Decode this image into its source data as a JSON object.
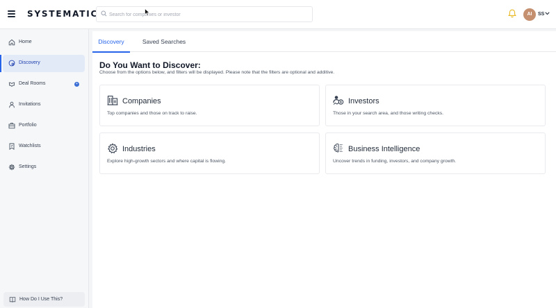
{
  "app": {
    "logo": "SYSTEMATIC",
    "search_placeholder": "Search for companies or investor"
  },
  "user": {
    "avatar_initials": "AI",
    "initials": "SS"
  },
  "colors": {
    "accent": "#2563eb",
    "bell": "#e8b923",
    "avatar": "#c4906f"
  },
  "sidebar": {
    "items": [
      {
        "label": "Home",
        "icon": "home-icon"
      },
      {
        "label": "Discovery",
        "icon": "compass-icon",
        "active": true
      },
      {
        "label": "Deal Rooms",
        "icon": "handshake-icon",
        "badge": "+"
      },
      {
        "label": "Invitations",
        "icon": "user-icon"
      },
      {
        "label": "Portfolio",
        "icon": "briefcase-icon"
      },
      {
        "label": "Watchlists",
        "icon": "bookmark-icon"
      },
      {
        "label": "Settings",
        "icon": "gear-icon"
      }
    ],
    "help_label": "How Do I Use This?"
  },
  "main": {
    "tabs": [
      {
        "label": "Discovery",
        "active": true
      },
      {
        "label": "Saved Searches"
      }
    ],
    "heading": "Do You Want to Discover:",
    "subheading": "Choose from the options below, and filters will be displayed. Please note that the filters are optional and additive.",
    "cards": [
      {
        "title": "Companies",
        "desc": "Top companies and those on track to raise.",
        "icon": "building-icon"
      },
      {
        "title": "Investors",
        "desc": "Those in your search area, and those writing checks.",
        "icon": "investor-icon"
      },
      {
        "title": "Industries",
        "desc": "Explore high-growth sectors and where capital is flowing.",
        "icon": "gear-icon"
      },
      {
        "title": "Business Intelligence",
        "desc": "Uncover trends in funding, investors, and company growth.",
        "icon": "brain-icon"
      }
    ]
  }
}
